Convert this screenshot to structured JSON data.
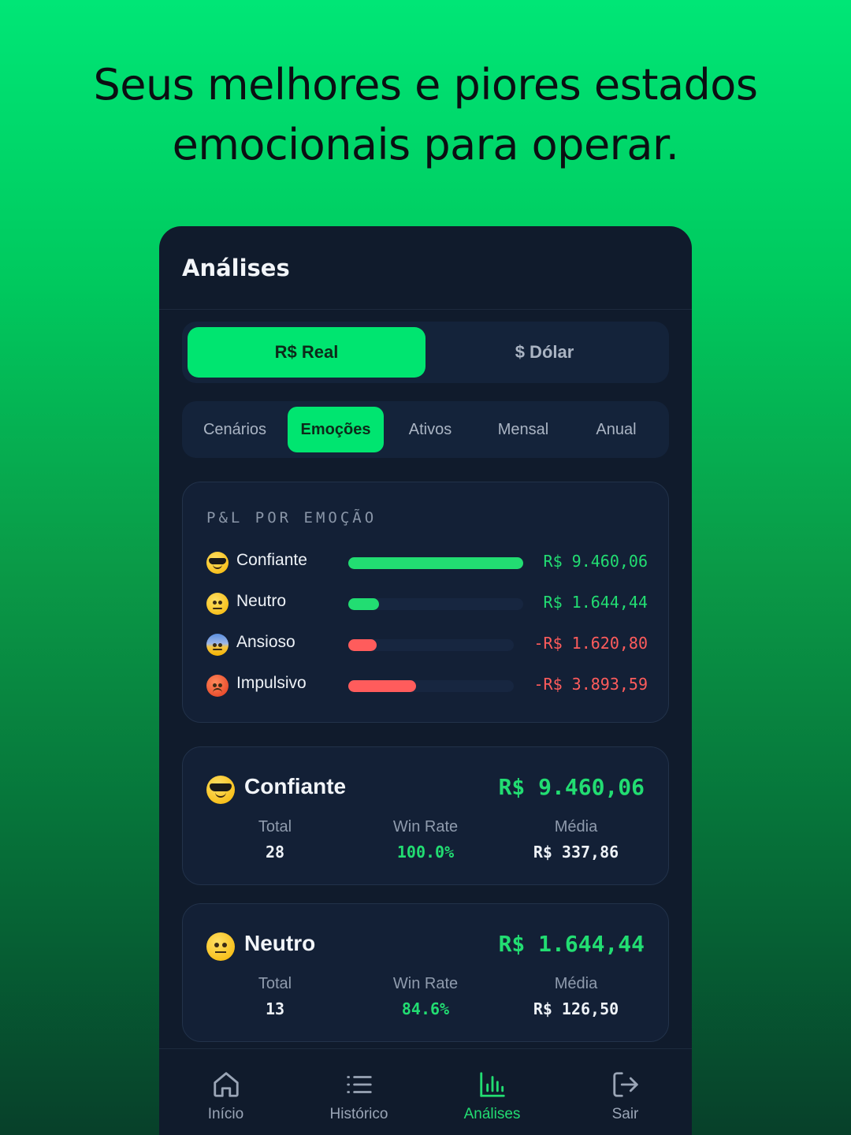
{
  "headline": {
    "line1": "Seus melhores e piores estados",
    "line2": "emocionais para operar."
  },
  "app": {
    "title": "Análises"
  },
  "currency": {
    "options": [
      {
        "label": "R$ Real",
        "active": true
      },
      {
        "label": "$ Dólar",
        "active": false
      }
    ]
  },
  "tabs": [
    {
      "label": "Cenários",
      "active": false
    },
    {
      "label": "Emoções",
      "active": true
    },
    {
      "label": "Ativos",
      "active": false
    },
    {
      "label": "Mensal",
      "active": false
    },
    {
      "label": "Anual",
      "active": false
    }
  ],
  "pnl": {
    "title": "P&L POR EMOÇÃO",
    "rows": [
      {
        "emoji": "sunglasses-face-icon",
        "label": "Confiante",
        "value": "R$ 9.460,06",
        "amount": 9460.06
      },
      {
        "emoji": "neutral-face-icon",
        "label": "Neutro",
        "value": "R$ 1.644,44",
        "amount": 1644.44
      },
      {
        "emoji": "anxious-face-icon",
        "label": "Ansioso",
        "value": "-R$ 1.620,80",
        "amount": -1620.8
      },
      {
        "emoji": "angry-face-icon",
        "label": "Impulsivo",
        "value": "-R$ 3.893,59",
        "amount": -3893.59
      }
    ]
  },
  "emotion_cards": [
    {
      "emoji": "sunglasses-face-icon",
      "name": "Confiante",
      "total_value": "R$ 9.460,06",
      "stats": {
        "total_label": "Total",
        "total_value": "28",
        "winrate_label": "Win Rate",
        "winrate_value": "100.0%",
        "media_label": "Média",
        "media_value": "R$ 337,86"
      }
    },
    {
      "emoji": "neutral-face-icon",
      "name": "Neutro",
      "total_value": "R$ 1.644,44",
      "stats": {
        "total_label": "Total",
        "total_value": "13",
        "winrate_label": "Win Rate",
        "winrate_value": "84.6%",
        "media_label": "Média",
        "media_value": "R$ 126,50"
      }
    }
  ],
  "nav": [
    {
      "icon": "home-icon",
      "label": "Início",
      "active": false
    },
    {
      "icon": "list-icon",
      "label": "Histórico",
      "active": false
    },
    {
      "icon": "bar-chart-icon",
      "label": "Análises",
      "active": true
    },
    {
      "icon": "logout-icon",
      "label": "Sair",
      "active": false
    }
  ],
  "colors": {
    "accent": "#00e570",
    "positive": "#22dd72",
    "negative": "#ff5c5c",
    "panel": "#101b2c",
    "card": "#132036"
  }
}
